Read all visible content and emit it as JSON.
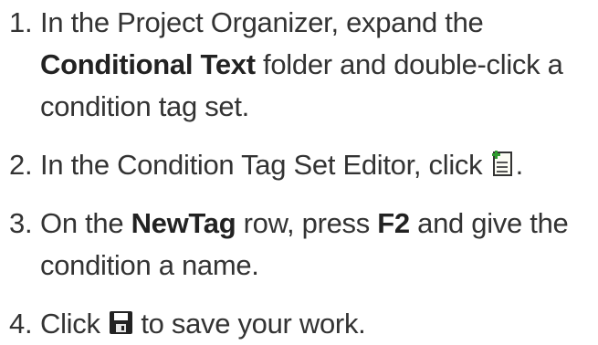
{
  "steps": [
    {
      "number": "1.",
      "text_1": "In the Project Organizer, expand the",
      "bold_1": "Conditional Text",
      "text_2": " folder and double-click a",
      "text_3": "condition tag set."
    },
    {
      "number": "2.",
      "text_1": "In the Condition Tag Set Editor, click",
      "icon": "new-tag-icon",
      "text_2": "."
    },
    {
      "number": "3.",
      "text_1": "On the ",
      "bold_1": "NewTag",
      "text_2": " row, press ",
      "bold_2": "F2",
      "text_3": " and give the",
      "text_4": "condition a name."
    },
    {
      "number": "4.",
      "text_1": "Click",
      "icon": "save-icon",
      "text_2": " to save your work."
    }
  ]
}
